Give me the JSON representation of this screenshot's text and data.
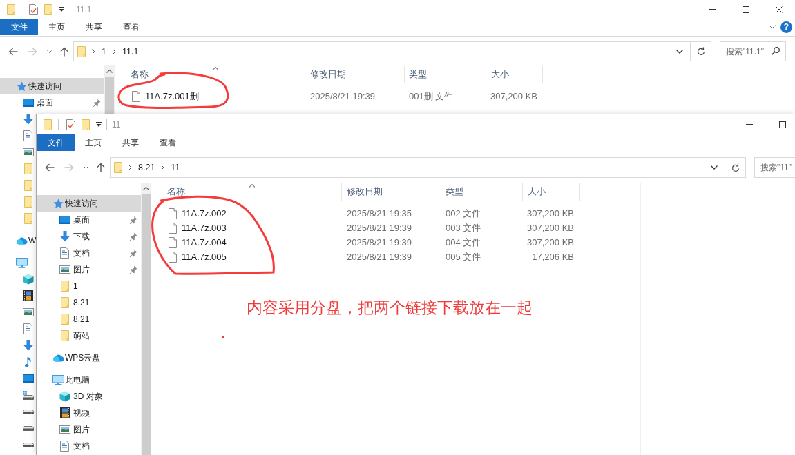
{
  "windows": [
    {
      "title": "11.1",
      "ribbon_tabs": [
        {
          "label": "文件",
          "kind": "file_menu"
        },
        {
          "label": "主页",
          "kind": "tab"
        },
        {
          "label": "共享",
          "kind": "tab"
        },
        {
          "label": "查看",
          "kind": "tab"
        }
      ],
      "help": "?",
      "breadcrumbs": [
        "1",
        "11.1"
      ],
      "search": {
        "placeholder": "搜索\"11.1\""
      },
      "nav_tree": [
        {
          "kind": "quick_access",
          "label": "快速访问",
          "selected": true,
          "children": [
            {
              "kind": "desktop",
              "label": "桌面",
              "selected": false,
              "pinned": true
            },
            {
              "kind": "downloads",
              "selected": false
            },
            {
              "kind": "documents",
              "selected": false
            },
            {
              "kind": "pictures",
              "selected": false
            },
            {
              "kind": "folder",
              "selected": false
            },
            {
              "kind": "folder",
              "selected": false
            },
            {
              "kind": "folder",
              "selected": false
            },
            {
              "kind": "folder",
              "selected": false
            }
          ]
        },
        {
          "kind": "cloud",
          "label": "W",
          "selected": false
        },
        {
          "kind": "pc",
          "selected": false,
          "children": [
            {
              "kind": "objects_3d",
              "selected": false
            },
            {
              "kind": "videos",
              "selected": false
            },
            {
              "kind": "pictures",
              "selected": false
            },
            {
              "kind": "documents",
              "selected": false
            },
            {
              "kind": "downloads",
              "selected": false
            },
            {
              "kind": "music",
              "selected": false
            },
            {
              "kind": "desktop",
              "selected": false
            },
            {
              "kind": "system_drive",
              "selected": false
            },
            {
              "kind": "drive",
              "selected": false
            },
            {
              "kind": "drive",
              "selected": false
            },
            {
              "kind": "drive",
              "selected": false
            }
          ]
        }
      ],
      "columns": [
        {
          "label": "名称",
          "sorted": true
        },
        {
          "label": "修改日期",
          "sorted": false
        },
        {
          "label": "类型",
          "sorted": false
        },
        {
          "label": "大小",
          "sorted": false
        }
      ],
      "files": [
        {
          "name": "11A.7z.001删",
          "modified": "2025/8/21 19:39",
          "type": "001删 文件",
          "size": "307,200 KB"
        }
      ]
    },
    {
      "title": "11",
      "ribbon_tabs": [
        {
          "label": "文件",
          "kind": "file_menu"
        },
        {
          "label": "主页",
          "kind": "tab"
        },
        {
          "label": "共享",
          "kind": "tab"
        },
        {
          "label": "查看",
          "kind": "tab"
        }
      ],
      "breadcrumbs": [
        "8.21",
        "11"
      ],
      "search": {
        "placeholder": "搜索\"11\""
      },
      "nav_tree": [
        {
          "kind": "quick_access",
          "label": "快速访问",
          "selected": true,
          "children": [
            {
              "kind": "desktop",
              "label": "桌面",
              "selected": false,
              "pinned": true
            },
            {
              "kind": "downloads",
              "label": "下载",
              "selected": false,
              "pinned": true
            },
            {
              "kind": "documents",
              "label": "文档",
              "selected": false,
              "pinned": true
            },
            {
              "kind": "pictures",
              "label": "图片",
              "selected": false,
              "pinned": true
            },
            {
              "kind": "folder",
              "label": "1",
              "selected": false,
              "pinned": false
            },
            {
              "kind": "folder",
              "label": "8.21",
              "selected": false,
              "pinned": false
            },
            {
              "kind": "folder",
              "label": "8.21",
              "selected": false,
              "pinned": false
            },
            {
              "kind": "folder",
              "label": "萌站",
              "selected": false,
              "pinned": false
            }
          ]
        },
        {
          "kind": "cloud",
          "label": "WPS云盘",
          "selected": false
        },
        {
          "kind": "pc",
          "label": "此电脑",
          "selected": false,
          "children": [
            {
              "kind": "objects_3d",
              "label": "3D 对象",
              "selected": false
            },
            {
              "kind": "videos",
              "label": "视频",
              "selected": false
            },
            {
              "kind": "pictures",
              "label": "图片",
              "selected": false
            },
            {
              "kind": "documents",
              "label": "文档",
              "selected": false
            }
          ]
        }
      ],
      "columns": [
        {
          "label": "名称",
          "sorted": true
        },
        {
          "label": "修改日期",
          "sorted": false
        },
        {
          "label": "类型",
          "sorted": false
        },
        {
          "label": "大小",
          "sorted": false
        }
      ],
      "files": [
        {
          "name": "11A.7z.002",
          "modified": "2025/8/21 19:35",
          "type": "002 文件",
          "size": "307,200 KB"
        },
        {
          "name": "11A.7z.003",
          "modified": "2025/8/21 19:39",
          "type": "003 文件",
          "size": "307,200 KB"
        },
        {
          "name": "11A.7z.004",
          "modified": "2025/8/21 19:39",
          "type": "004 文件",
          "size": "307,200 KB"
        },
        {
          "name": "11A.7z.005",
          "modified": "2025/8/21 19:39",
          "type": "005 文件",
          "size": "17,206 KB"
        }
      ]
    }
  ],
  "annotation": {
    "note": "内容采用分盘，把两个链接下载放在一起"
  }
}
